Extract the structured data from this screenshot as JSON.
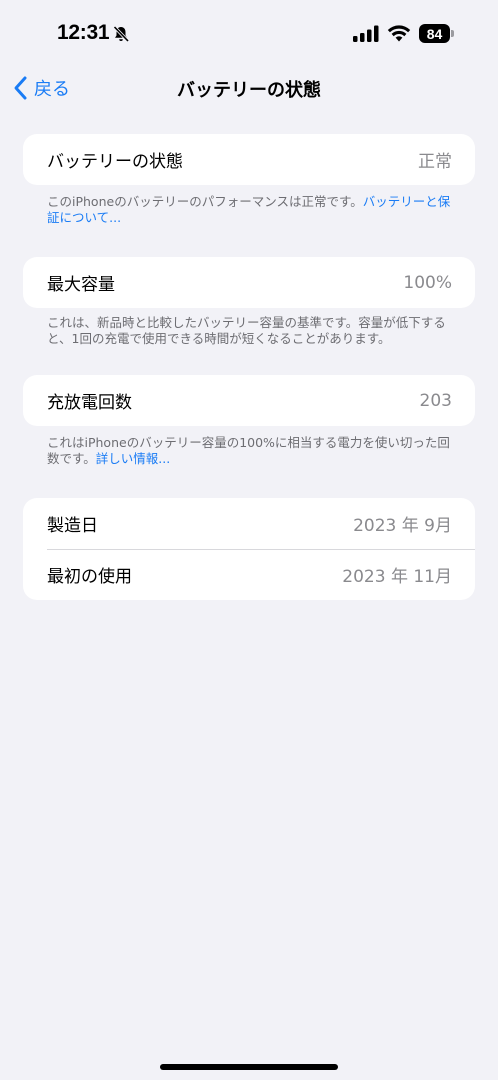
{
  "status_bar": {
    "time": "12:31",
    "battery_level": "84",
    "icons": [
      "bell-slash-icon",
      "cellular-signal-icon",
      "wifi-icon",
      "battery-icon"
    ]
  },
  "nav": {
    "back_label": "戻る",
    "title": "バッテリーの状態",
    "back_icon": "chevron-left-icon"
  },
  "health": {
    "label": "バッテリーの状態",
    "value": "正常",
    "footnote_text": "このiPhoneのバッテリーのパフォーマンスは正常です。",
    "footnote_link": "バッテリーと保証について..."
  },
  "capacity": {
    "label": "最大容量",
    "value": "100%",
    "footnote": "これは、新品時と比較したバッテリー容量の基準です。容量が低下すると、1回の充電で使用できる時間が短くなることがあります。"
  },
  "cycles": {
    "label": "充放電回数",
    "value": "203",
    "footnote_text": "これはiPhoneのバッテリー容量の100%に相当する電力を使い切った回数です。",
    "footnote_link": "詳しい情報..."
  },
  "dates": {
    "manufacture_label": "製造日",
    "manufacture_value": "2023 年 9月",
    "first_use_label": "最初の使用",
    "first_use_value": "2023 年 11月"
  },
  "colors": {
    "accent": "#1a7cf5",
    "background": "#f2f2f7",
    "secondary_text": "#8a8a8e"
  }
}
